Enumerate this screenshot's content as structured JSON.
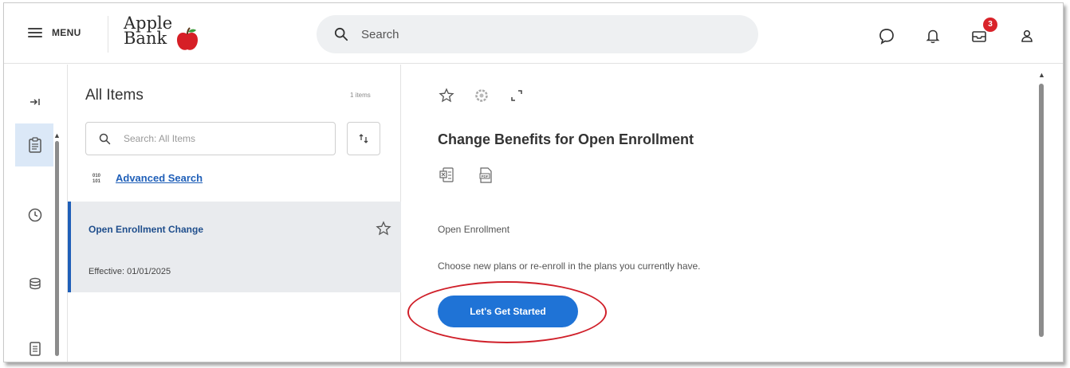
{
  "header": {
    "menu_label": "MENU",
    "logo_line1": "Apple",
    "logo_line2": "Bank",
    "search_placeholder": "Search",
    "inbox_badge": "3",
    "icons": [
      "chat-icon",
      "notification-bell-icon",
      "inbox-icon",
      "profile-icon"
    ]
  },
  "rail": {
    "icons": [
      "collapse-icon",
      "clipboard-icon",
      "clock-icon",
      "stack-icon",
      "document-icon"
    ]
  },
  "panel": {
    "title": "All Items",
    "count": "1 items",
    "search_placeholder": "Search: All Items",
    "advanced_search": "Advanced Search",
    "items": [
      {
        "title": "Open Enrollment Change",
        "effective": "Effective: 01/01/2025"
      }
    ]
  },
  "detail": {
    "icons": [
      "star-icon",
      "settings-icon",
      "expand-icon"
    ],
    "title": "Change Benefits for Open Enrollment",
    "doc_icons": [
      "excel-export-icon",
      "pdf-export-icon"
    ],
    "subtitle": "Open Enrollment",
    "description": "Choose new plans or re-enroll in the plans you currently have.",
    "start_button": "Let's Get Started"
  },
  "colors": {
    "accent": "#1f73d6",
    "link": "#1f5fb8",
    "badge": "#d9232a",
    "highlight_circle": "#d0202a",
    "selected_bg": "#e9ebee",
    "rail_active": "#dbe8f7"
  }
}
